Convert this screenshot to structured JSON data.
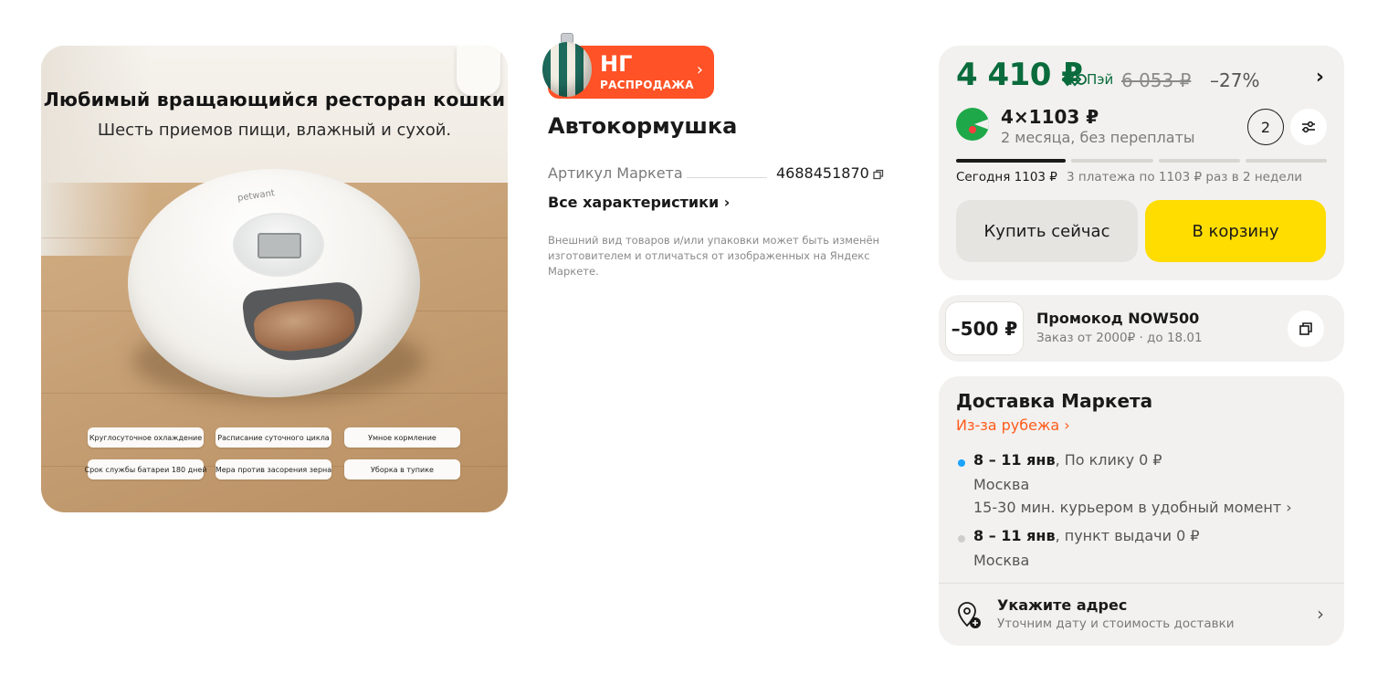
{
  "gallery": {
    "headline": "Любимый вращающийся ресторан кошки",
    "subline": "Шесть приемов пищи, влажный и сухой.",
    "brand": "petwant",
    "features": [
      "Круглосуточное охлаждение",
      "Расписание суточного цикла",
      "Умное кормление",
      "Срок службы батареи 180 дней",
      "Мера против засорения зерна",
      "Уборка в тупике"
    ]
  },
  "sale_badge": {
    "line1": "НГ",
    "line2": "РАСПРОДАЖА",
    "chevron": "›"
  },
  "product": {
    "title": "Автокормушка",
    "sku_label": "Артикул Маркета",
    "sku_value": "4688451870",
    "all_specs": "Все характеристики ›",
    "disclaimer": "Внешний вид товаров и/или упаковки может быть изменён изготовителем и отличаться от изображенных  на Яндекс Маркете."
  },
  "price": {
    "current": "4 410 ₽",
    "pay_label": "Пэй",
    "old": "6 053 ₽",
    "discount": "–27%",
    "chevron": "›",
    "split_main": "4×1103 ₽",
    "split_sub": "2 месяца, без переплаты",
    "quantity": "2",
    "schedule_today": "Сегодня 1103 ₽",
    "schedule_rest": "3 платежа по 1103 ₽ раз в 2 недели",
    "buy_now": "Купить сейчас",
    "add_to_cart": "В корзину"
  },
  "promo": {
    "amount": "–500 ₽",
    "title": "Промокод NOW500",
    "subtitle": "Заказ от 2000₽ · до 18.01"
  },
  "delivery": {
    "title": "Доставка Маркета",
    "origin": "Из-за рубежа ›",
    "options": [
      {
        "dates": "8 – 11 янв",
        "method": ", По клику  0 ₽",
        "city": "Москва",
        "note": "15-30 мин. курьером в удобный момент ›"
      },
      {
        "dates": "8 – 11 янв",
        "method": ", пункт выдачи  0 ₽",
        "city": "Москва"
      }
    ],
    "address_title": "Укажите адрес",
    "address_sub": "Уточним дату и стоимость доставки",
    "address_chevron": "›"
  },
  "colors": {
    "price_green": "#0a6b3c",
    "sale_orange": "#ff5226",
    "cart_yellow": "#ffdd00",
    "card_bg": "#f2f1ef",
    "link_orange": "#ff5a1a",
    "bullet_active": "#1aa3ff",
    "bullet_inactive": "#cfcdc9"
  }
}
